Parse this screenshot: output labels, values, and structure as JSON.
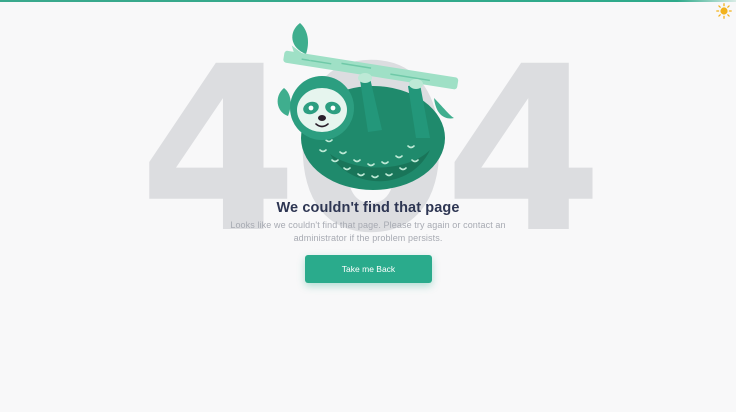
{
  "error_code": "404",
  "title": "We couldn't find that page",
  "message": "Looks like we couldn't find that page. Please try again or contact an administrator if the problem persists.",
  "back_button_label": "Take me Back",
  "theme_toggle_icon": "sun-icon",
  "illustration_icon": "sloth-illustration",
  "colors": {
    "accent": "#2aab8c",
    "title": "#2e3653",
    "muted_text": "#a7aab2",
    "background_number": "#dcdde0",
    "sun": "#f2b21c",
    "background": "#f8f8f9"
  }
}
